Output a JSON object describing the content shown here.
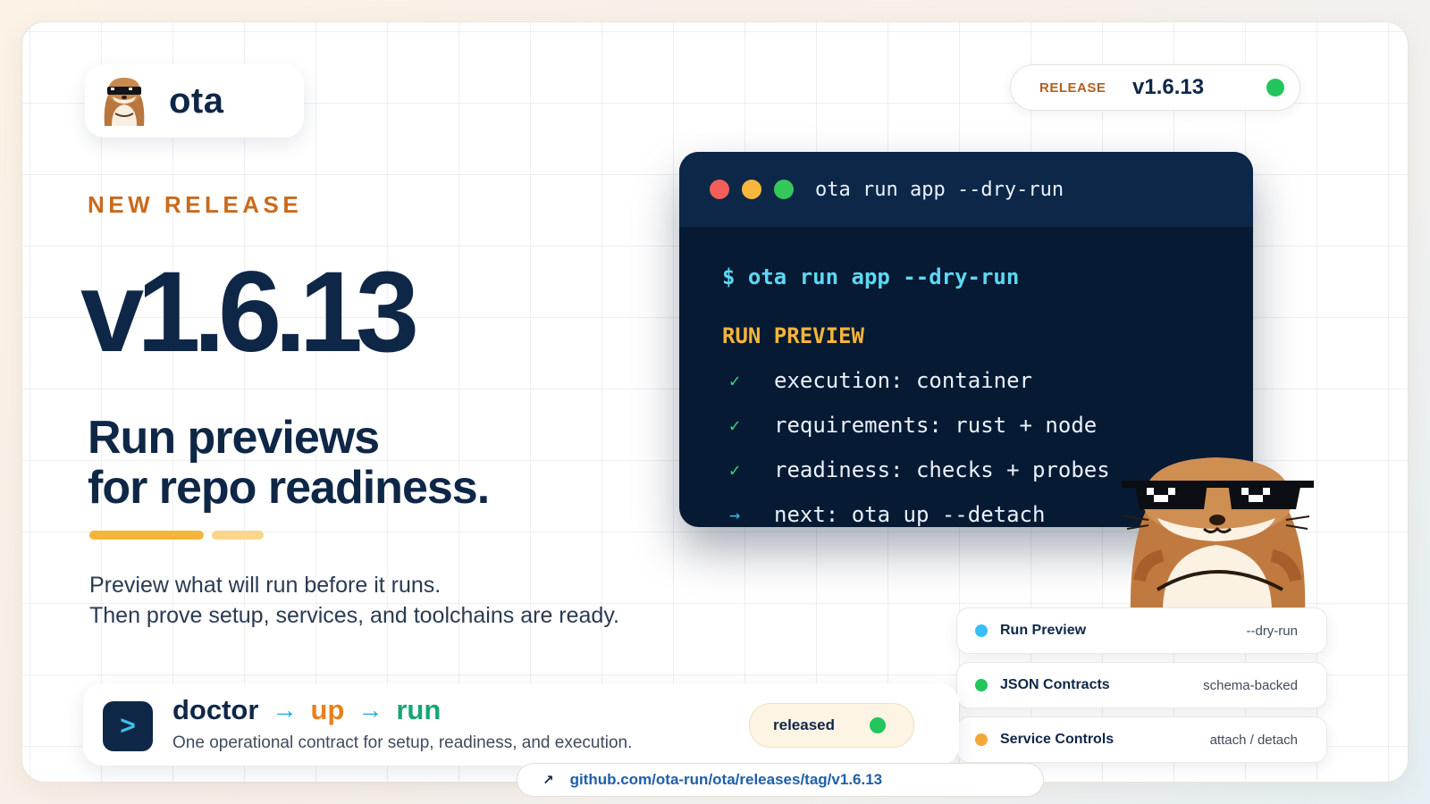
{
  "brand": {
    "name": "ota",
    "mascot_icon": "otter-sunglasses-icon"
  },
  "release_pill": {
    "label": "RELEASE",
    "version": "v1.6.13",
    "status_color": "#22c55e"
  },
  "hero": {
    "eyebrow": "NEW RELEASE",
    "version": "v1.6.13",
    "headline_line1": "Run previews",
    "headline_line2": "for repo readiness.",
    "desc_line1": "Preview what will run before it runs.",
    "desc_line2": "Then prove setup, services, and toolchains are ready."
  },
  "terminal": {
    "title": "ota run app --dry-run",
    "command": "$ ota run app --dry-run",
    "section": "RUN PREVIEW",
    "lines": [
      {
        "mark": "✓",
        "text": "execution: container"
      },
      {
        "mark": "✓",
        "text": "requirements: rust + node"
      },
      {
        "mark": "✓",
        "text": "readiness: checks + probes"
      },
      {
        "mark": "→",
        "text": "next: ota up --detach"
      }
    ]
  },
  "features": [
    {
      "name": "Run Preview",
      "detail": "--dry-run",
      "color": "#38bdf8"
    },
    {
      "name": "JSON Contracts",
      "detail": "schema-backed",
      "color": "#22c55e"
    },
    {
      "name": "Service Controls",
      "detail": "attach / detach",
      "color": "#f5a83a"
    }
  ],
  "bottom": {
    "prompt_glyph": ">",
    "flow": [
      "doctor",
      "up",
      "run"
    ],
    "tagline": "One operational contract for setup, readiness, and execution.",
    "status_label": "released"
  },
  "link": {
    "icon": "↗",
    "url": "github.com/ota-run/ota/releases/tag/v1.6.13"
  },
  "colors": {
    "navy": "#0f2747",
    "accent_orange": "#c96a1c",
    "accent_yellow": "#f5b43a",
    "terminal_bg": "#061a33",
    "cyan": "#5ed7f2",
    "green": "#22c55e"
  }
}
